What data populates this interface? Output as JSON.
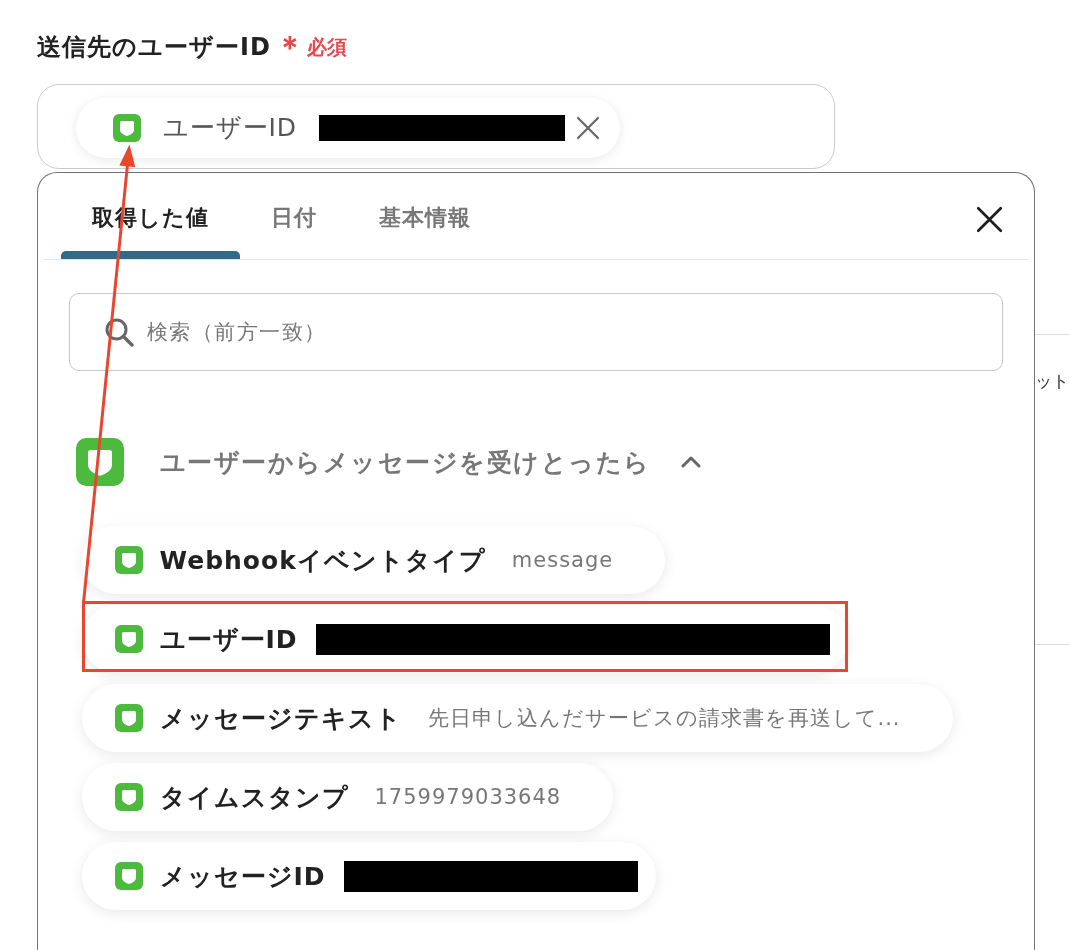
{
  "field": {
    "label": "送信先のユーザーID",
    "required_mark": "＊",
    "required_text": "必須",
    "chip": {
      "label": "ユーザーID",
      "redacted": true
    }
  },
  "background": {
    "text": "ット"
  },
  "picker": {
    "tabs": [
      {
        "label": "取得した値",
        "selected": true
      },
      {
        "label": "日付",
        "selected": false
      },
      {
        "label": "基本情報",
        "selected": false
      }
    ],
    "search": {
      "placeholder": "検索（前方一致）"
    },
    "groups": [
      {
        "title": "ユーザーからメッセージを受けとったら",
        "expanded": true,
        "items": [
          {
            "label": "Webhookイベントタイプ",
            "value": "message",
            "redacted": false,
            "highlighted": false
          },
          {
            "label": "ユーザーID",
            "redacted": true,
            "highlighted": true
          },
          {
            "label": "メッセージテキスト",
            "value": "先日申し込んだサービスの請求書を再送して...",
            "redacted": false,
            "highlighted": false
          },
          {
            "label": "タイムスタンプ",
            "value": "1759979033648",
            "redacted": false,
            "highlighted": false
          },
          {
            "label": "メッセージID",
            "redacted": true,
            "highlighted": false
          }
        ]
      }
    ]
  },
  "annotation": {
    "arrow": true
  }
}
